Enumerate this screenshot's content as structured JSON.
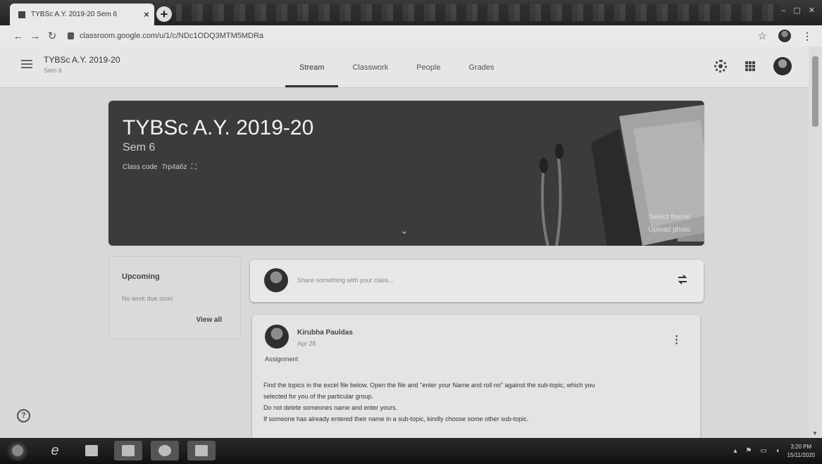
{
  "browser": {
    "tab_title": "TYBSc A.Y. 2019-20 Sem 6",
    "new_tab": "+",
    "url": "classroom.google.com/u/1/c/NDc1ODQ3MTM5MDRa"
  },
  "header": {
    "class_title": "TYBSc A.Y. 2019-20",
    "class_sub": "Sem 6",
    "tabs": [
      {
        "label": "Stream"
      },
      {
        "label": "Classwork"
      },
      {
        "label": "People"
      },
      {
        "label": "Grades"
      }
    ]
  },
  "banner": {
    "title": "TYBSc A.Y. 2019-20",
    "subtitle": "Sem 6",
    "class_code_label": "Class code",
    "class_code": "7rp4a6z",
    "select_theme": "Select theme",
    "upload_photo": "Upload photo"
  },
  "upcoming": {
    "title": "Upcoming",
    "empty": "No work due soon",
    "view_all": "View all"
  },
  "share": {
    "placeholder": "Share something with your class..."
  },
  "post": {
    "author": "Kirubha Pauldas",
    "date": "Apr 28",
    "type": "Assignment",
    "lines": [
      "Find the topics in the excel file below. Open the file and \"enter your Name and roll no\" against the sub-topic, which you",
      "selected for you of the particular group.",
      "Do not delete someones name and enter yours.",
      "If someone has already entered their name in a sub-topic, kindly choose some other sub-topic."
    ]
  },
  "taskbar": {
    "time": "3:20 PM",
    "date": "15/11/2020"
  }
}
